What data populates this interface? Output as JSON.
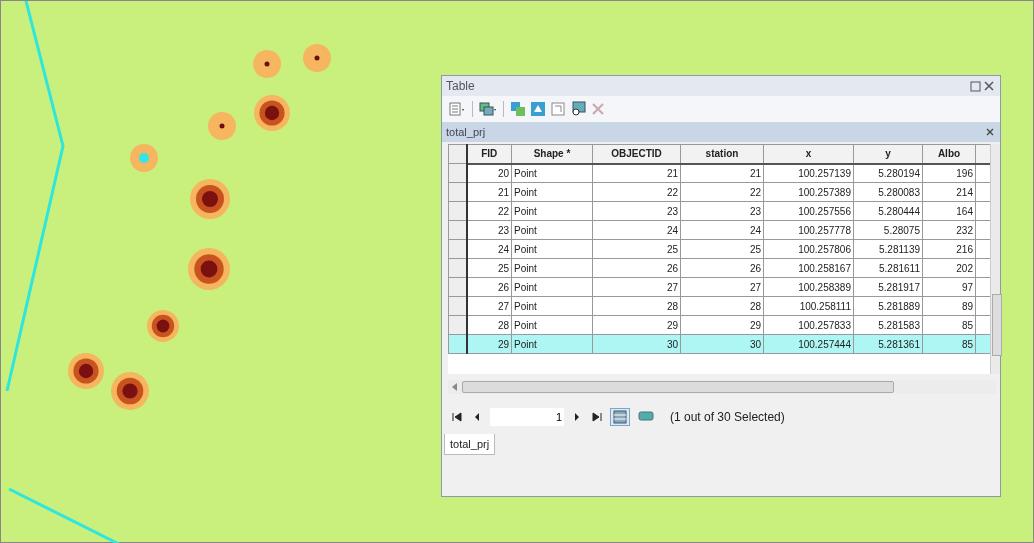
{
  "window": {
    "title": "Table"
  },
  "tab": {
    "label": "total_prj"
  },
  "table": {
    "columns": [
      "FID",
      "Shape *",
      "OBJECTID",
      "station",
      "x",
      "y",
      "Albo",
      ""
    ],
    "rows": [
      {
        "cells": [
          "20",
          "Point",
          "21",
          "21",
          "100.257139",
          "5.280194",
          "196"
        ],
        "selected": false
      },
      {
        "cells": [
          "21",
          "Point",
          "22",
          "22",
          "100.257389",
          "5.280083",
          "214"
        ],
        "selected": false
      },
      {
        "cells": [
          "22",
          "Point",
          "23",
          "23",
          "100.257556",
          "5.280444",
          "164"
        ],
        "selected": false
      },
      {
        "cells": [
          "23",
          "Point",
          "24",
          "24",
          "100.257778",
          "5.28075",
          "232"
        ],
        "selected": false
      },
      {
        "cells": [
          "24",
          "Point",
          "25",
          "25",
          "100.257806",
          "5.281139",
          "216"
        ],
        "selected": false
      },
      {
        "cells": [
          "25",
          "Point",
          "26",
          "26",
          "100.258167",
          "5.281611",
          "202"
        ],
        "selected": false
      },
      {
        "cells": [
          "26",
          "Point",
          "27",
          "27",
          "100.258389",
          "5.281917",
          "97"
        ],
        "selected": false
      },
      {
        "cells": [
          "27",
          "Point",
          "28",
          "28",
          "100.258111",
          "5.281889",
          "89"
        ],
        "selected": false
      },
      {
        "cells": [
          "28",
          "Point",
          "29",
          "29",
          "100.257833",
          "5.281583",
          "85"
        ],
        "selected": false
      },
      {
        "cells": [
          "29",
          "Point",
          "30",
          "30",
          "100.257444",
          "5.281361",
          "85"
        ],
        "selected": true
      }
    ]
  },
  "navigator": {
    "record": "1",
    "views": [
      {
        "kind": "all",
        "selected": true
      },
      {
        "kind": "selected",
        "selected": false
      }
    ],
    "status": "(1 out of 30 Selected)"
  },
  "bottom_tabs": [
    {
      "label": "total_prj",
      "selected": true
    }
  ]
}
